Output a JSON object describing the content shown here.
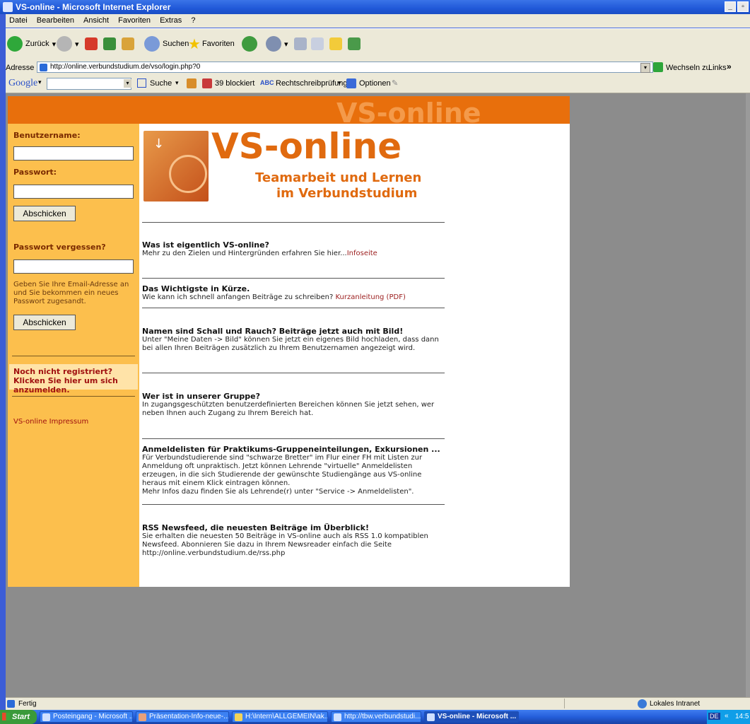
{
  "window": {
    "title": "VS-online - Microsoft Internet Explorer"
  },
  "menu": [
    "Datei",
    "Bearbeiten",
    "Ansicht",
    "Favoriten",
    "Extras",
    "?"
  ],
  "toolbar": {
    "back": "Zurück",
    "search": "Suchen",
    "favorites": "Favoriten"
  },
  "address": {
    "label": "Adresse",
    "url": "http://online.verbundstudium.de/vso/login.php?0",
    "go": "Wechseln zu",
    "links": "Links"
  },
  "google": {
    "logo": "Google",
    "search": "Suche",
    "blocked": "39 blockiert",
    "spell": "Rechtschreibprüfung",
    "options": "Optionen"
  },
  "banner": {
    "watermark": "VS-online"
  },
  "logo": {
    "title": "VS-online",
    "line1": "Teamarbeit und Lernen",
    "line2": "im Verbundstudium"
  },
  "sidebar": {
    "username_label": "Benutzername:",
    "password_label": "Passwort:",
    "submit1": "Abschicken",
    "forgot_label": "Passwort vergessen?",
    "forgot_text": "Geben Sie Ihre Email-Adresse an und Sie bekommen ein neues Passwort zugesandt.",
    "submit2": "Abschicken",
    "register": "Noch nicht registriert? Klicken Sie hier um sich anzumelden.",
    "impressum": "VS-online Impressum"
  },
  "news": [
    {
      "title": "Was ist eigentlich VS-online?",
      "text": "Mehr zu den Zielen und Hintergründen erfahren Sie hier...",
      "link": "Infoseite"
    },
    {
      "title": "Das Wichtigste in Kürze.",
      "text": "Wie kann ich schnell anfangen Beiträge zu schreiben? ",
      "link": "Kurzanleitung (PDF)"
    },
    {
      "title": "Namen sind Schall und Rauch? Beiträge jetzt auch mit Bild!",
      "text": "Unter \"Meine Daten -> Bild\" können Sie jetzt ein eigenes Bild hochladen, dass dann bei allen Ihren Beiträgen zusätzlich zu Ihrem Benutzernamen angezeigt wird."
    },
    {
      "title": "Wer ist in unserer Gruppe?",
      "text": "In zugangsgeschützten benutzerdefinierten Bereichen können Sie jetzt sehen, wer neben Ihnen auch Zugang zu Ihrem Bereich hat."
    },
    {
      "title": "Anmeldelisten für Praktikums-Gruppeneinteilungen, Exkursionen ...",
      "text": "Für Verbundstudierende sind \"schwarze Bretter\" im Flur einer FH mit Listen zur Anmeldung oft unpraktisch. Jetzt können Lehrende \"virtuelle\" Anmeldelisten erzeugen, in die sich Studierende der gewünschte Studiengänge aus VS-online heraus mit einem Klick eintragen können.",
      "text2": "Mehr Infos dazu finden Sie als Lehrende(r) unter \"Service -> Anmeldelisten\"."
    },
    {
      "title": "RSS Newsfeed, die neuesten Beiträge im Überblick!",
      "text": "Sie erhalten die neuesten 50 Beiträge in VS-online auch als RSS 1.0 kompatiblen Newsfeed. Abonnieren Sie dazu in Ihrem Newsreader einfach die Seite http://online.verbundstudium.de/rss.php"
    }
  ],
  "status": {
    "text": "Fertig",
    "zone": "Lokales Intranet"
  },
  "taskbar": {
    "start": "Start",
    "tasks": [
      "Posteingang - Microsoft ...",
      "Präsentation-Info-neue-...",
      "H:\\Intern\\ALLGEMEIN\\ak...",
      "http://tbw.verbundstudi...",
      "VS-online - Microsoft ..."
    ],
    "lang": "DE",
    "clock": "14:5"
  }
}
